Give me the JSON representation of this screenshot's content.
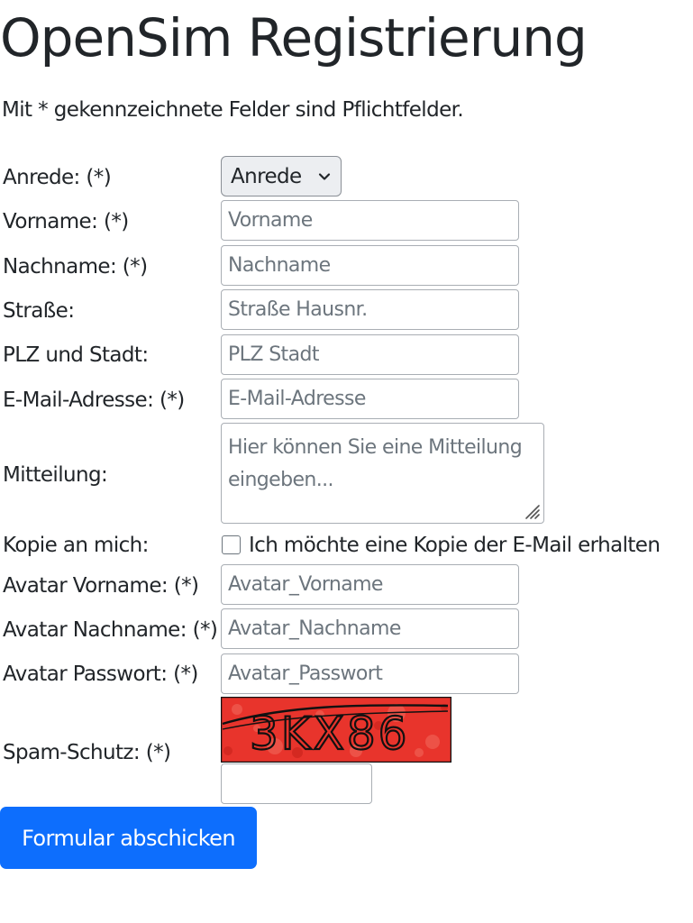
{
  "heading": "OpenSim Registrierung",
  "intro": "Mit * gekennzeichnete Felder sind Pflichtfelder.",
  "form": {
    "salutation": {
      "label": "Anrede: (*)",
      "selected": "Anrede"
    },
    "firstname": {
      "label": "Vorname: (*)",
      "value": "",
      "placeholder": "Vorname"
    },
    "lastname": {
      "label": "Nachname: (*)",
      "value": "",
      "placeholder": "Nachname"
    },
    "street": {
      "label": "Straße:",
      "value": "",
      "placeholder": "Straße Hausnr."
    },
    "city": {
      "label": "PLZ und Stadt:",
      "value": "",
      "placeholder": "PLZ Stadt"
    },
    "email": {
      "label": "E-Mail-Adresse: (*)",
      "value": "",
      "placeholder": "E-Mail-Adresse"
    },
    "message": {
      "label": "Mitteilung:",
      "value": "",
      "placeholder": "Hier können Sie eine Mitteilung eingeben..."
    },
    "copy": {
      "label": "Kopie an mich:",
      "checkbox_label": "Ich möchte eine Kopie der E-Mail erhalten",
      "checked": false
    },
    "avatar_firstname": {
      "label": "Avatar Vorname: (*)",
      "value": "",
      "placeholder": "Avatar_Vorname"
    },
    "avatar_lastname": {
      "label": "Avatar Nachname: (*)",
      "value": "",
      "placeholder": "Avatar_Nachname"
    },
    "avatar_password": {
      "label": "Avatar Passwort: (*)",
      "value": "",
      "placeholder": "Avatar_Passwort"
    },
    "captcha": {
      "label": "Spam-Schutz: (*)",
      "code": "3KX86",
      "value": ""
    },
    "submit_label": "Formular abschicken"
  },
  "colors": {
    "primary": "#0d6efd",
    "text": "#212529",
    "placeholder": "#6c757d",
    "border": "#a9aeb4",
    "captcha_bg": "#e8342c"
  },
  "icons": {
    "select_arrow": "chevron-down-icon",
    "resize_handle": "resize-grip-icon"
  }
}
